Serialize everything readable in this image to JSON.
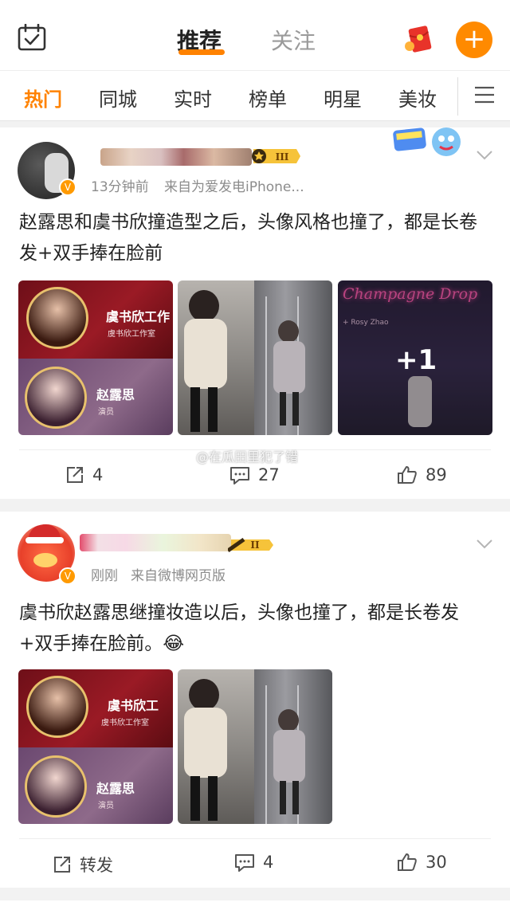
{
  "header": {
    "tabs": [
      {
        "label": "推荐",
        "active": true
      },
      {
        "label": "关注",
        "active": false
      }
    ],
    "plus_label": "+",
    "accent_color": "#ff8200"
  },
  "categories": [
    "热门",
    "同城",
    "实时",
    "榜单",
    "明星",
    "美妆"
  ],
  "posts": [
    {
      "time": "13分钟前",
      "source": "来自为爱发电iPhone...",
      "level_badge": "III",
      "text": "赵露思和虞书欣撞造型之后，头像风格也撞了，都是长卷发+双手捧在脸前",
      "images": {
        "card_top_name": "虞书欣工作",
        "card_top_sub": "虞书欣工作室",
        "card_bottom_name": "赵露思",
        "card_bottom_sub": "演员",
        "neon_text": "Champagne Drop",
        "neon_sub": "+ Rosy Zhao",
        "more_count": "+1"
      },
      "actions": {
        "repost": "4",
        "comment": "27",
        "like": "89"
      }
    },
    {
      "time": "刚刚",
      "source": "来自微博网页版",
      "level_badge": "II",
      "text": "虞书欣赵露思继撞妆造以后，头像也撞了，都是长卷发+双手捧在脸前。😂",
      "images": {
        "card_top_name": "虞书欣工",
        "card_top_sub": "虞书欣工作室",
        "card_bottom_name": "赵露思",
        "card_bottom_sub": "演员"
      },
      "actions": {
        "repost": "转发",
        "comment": "4",
        "like": "30"
      }
    }
  ],
  "watermark": "@在瓜田里犯了错"
}
